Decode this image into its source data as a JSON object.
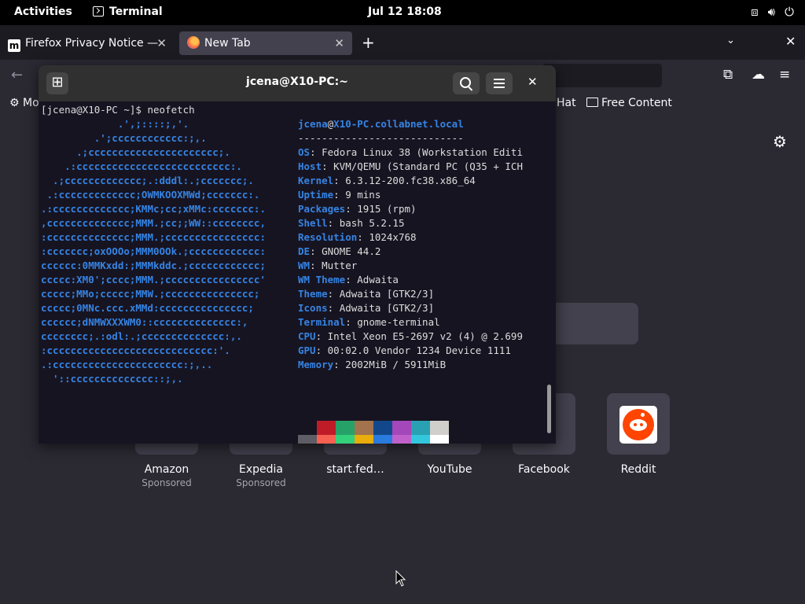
{
  "topbar": {
    "activities": "Activities",
    "app_name": "Terminal",
    "clock": "Jul 12  18:08",
    "tray_icons": [
      "network-icon",
      "volume-icon",
      "power-icon"
    ]
  },
  "browser": {
    "tabs": [
      {
        "title": "Firefox Privacy Notice — ",
        "favicon": "m"
      },
      {
        "title": "New Tab",
        "favicon": "firefox-icon"
      }
    ],
    "new_tab_symbol": "+",
    "bookmarks": {
      "first": "Mo",
      "hat": "Hat",
      "free_content": "Free Content"
    },
    "shortcuts": [
      {
        "label": "Amazon",
        "sub": "Sponsored"
      },
      {
        "label": "Expedia",
        "sub": "Sponsored"
      },
      {
        "label": "start.fed…",
        "sub": ""
      },
      {
        "label": "YouTube",
        "sub": ""
      },
      {
        "label": "Facebook",
        "sub": ""
      },
      {
        "label": "Reddit",
        "sub": ""
      }
    ]
  },
  "terminal": {
    "title": "jcena@X10-PC:~",
    "prompt": "[jcena@X10-PC ~]$ neofetch",
    "ascii_art": [
      "             .',;::::;,'.",
      "         .';cccccccccccc:;,.",
      "      .;cccccccccccccccccccccc;.",
      "    .:cccccccccccccccccccccccccc:.",
      "  .;ccccccccccccc;.:dddl:.;ccccccc;.",
      " .:ccccccccccccc;OWMKOOXMWd;ccccccc:.",
      ".:ccccccccccccc;KMMc;cc;xMMc:ccccccc:.",
      ",cccccccccccccc;MMM.;cc;;WW::cccccccc,",
      ":cccccccccccccc;MMM.;cccccccccccccccc:",
      ":ccccccc;oxOOOo;MMM0OOk.;cccccccccccc:",
      "cccccc:0MMKxdd:;MMMkddc.;cccccccccccc;",
      "ccccc:XM0';cccc;MMM.;cccccccccccccccc'",
      "ccccc;MMo;ccccc;MMW.;ccccccccccccccc;",
      "ccccc;0MNc.ccc.xMMd:ccccccccccccccc;",
      "cccccc;dNMWXXXWM0::cccccccccccccc:,",
      "cccccccc;.:odl:.;cccccccccccccc:,.",
      ":cccccccccccccccccccccccccccc:'.",
      ".:cccccccccccccccccccccc:;,..",
      "  '::cccccccccccccc::;,."
    ],
    "user_host": {
      "user": "jcena",
      "at": "@",
      "host": "X10-PC.collabnet.local"
    },
    "separator": "----------------------------",
    "info": [
      {
        "key": "OS",
        "value": "Fedora Linux 38 (Workstation Editi"
      },
      {
        "key": "Host",
        "value": "KVM/QEMU (Standard PC (Q35 + ICH"
      },
      {
        "key": "Kernel",
        "value": "6.3.12-200.fc38.x86_64"
      },
      {
        "key": "Uptime",
        "value": "9 mins"
      },
      {
        "key": "Packages",
        "value": "1915 (rpm)"
      },
      {
        "key": "Shell",
        "value": "bash 5.2.15"
      },
      {
        "key": "Resolution",
        "value": "1024x768"
      },
      {
        "key": "DE",
        "value": "GNOME 44.2"
      },
      {
        "key": "WM",
        "value": "Mutter"
      },
      {
        "key": "WM Theme",
        "value": "Adwaita"
      },
      {
        "key": "Theme",
        "value": "Adwaita [GTK2/3]"
      },
      {
        "key": "Icons",
        "value": "Adwaita [GTK2/3]"
      },
      {
        "key": "Terminal",
        "value": "gnome-terminal"
      },
      {
        "key": "CPU",
        "value": "Intel Xeon E5-2697 v2 (4) @ 2.699"
      },
      {
        "key": "GPU",
        "value": "00:02.0 Vendor 1234 Device 1111"
      },
      {
        "key": "Memory",
        "value": "2002MiB / 5911MiB"
      }
    ],
    "palette_top": [
      "#171421",
      "#c01c28",
      "#26a269",
      "#a2734c",
      "#12488b",
      "#a347ba",
      "#2aa1b3",
      "#d0cfcc"
    ],
    "palette_bottom": [
      "#5e5c64",
      "#f66151",
      "#33d17a",
      "#e9ad0c",
      "#2a7bde",
      "#c061cb",
      "#33c7de",
      "#ffffff"
    ]
  }
}
